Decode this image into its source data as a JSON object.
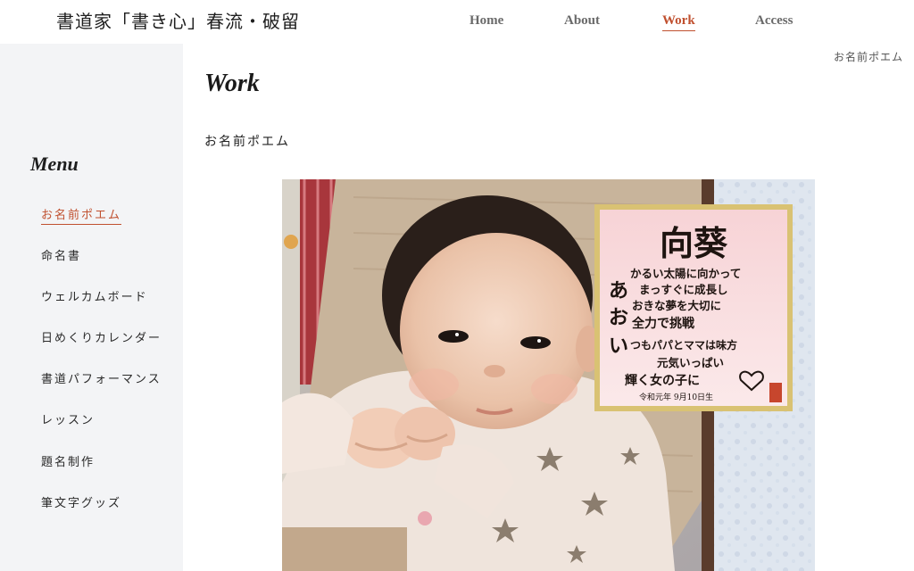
{
  "header": {
    "site_title": "書道家「書き心」春流・破留",
    "nav": [
      {
        "label": "Home"
      },
      {
        "label": "About"
      },
      {
        "label": "Work"
      },
      {
        "label": "Access"
      }
    ]
  },
  "breadcrumb": "お名前ポエム",
  "main": {
    "title": "Work",
    "section_title": "お名前ポエム"
  },
  "sidebar": {
    "heading": "Menu",
    "items": [
      {
        "label": "お名前ポエム"
      },
      {
        "label": "命名書"
      },
      {
        "label": "ウェルカムボード"
      },
      {
        "label": "日めくりカレンダー"
      },
      {
        "label": "書道パフォーマンス"
      },
      {
        "label": "レッスン"
      },
      {
        "label": "題名制作"
      },
      {
        "label": "筆文字グッズ"
      }
    ]
  },
  "photo": {
    "board": {
      "name": "向葵",
      "lines": [
        "かるい太陽に向かって",
        "まっすぐに成長し",
        "おきな夢を大切に",
        "全力で挑戦",
        "つもパパとママは味方",
        "元気いっぱい",
        "輝く女の子に"
      ],
      "initials": [
        "あ",
        "お",
        "い"
      ],
      "date": "令和元年 9月10日生"
    }
  },
  "colors": {
    "accent": "#c0502f",
    "sidebar_bg": "#f3f4f6",
    "text": "#222222"
  }
}
